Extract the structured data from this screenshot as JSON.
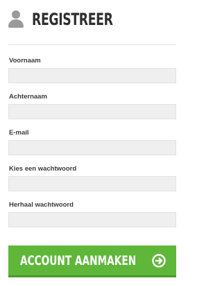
{
  "header": {
    "icon": "user-icon",
    "title": "REGISTREER"
  },
  "form": {
    "fields": [
      {
        "label": "Voornaam",
        "value": "",
        "placeholder": ""
      },
      {
        "label": "Achternaam",
        "value": "",
        "placeholder": ""
      },
      {
        "label": "E-mail",
        "value": "",
        "placeholder": ""
      },
      {
        "label": "Kies een wachtwoord",
        "value": "",
        "placeholder": ""
      },
      {
        "label": "Herhaal wachtwoord",
        "value": "",
        "placeholder": ""
      }
    ],
    "submit": {
      "label": "ACCOUNT AANMAKEN",
      "icon": "arrow-right-circle-icon"
    }
  },
  "colors": {
    "input_background": "#efefef",
    "button_green": "#5fb73a",
    "icon_gray": "#9a9a9a"
  }
}
